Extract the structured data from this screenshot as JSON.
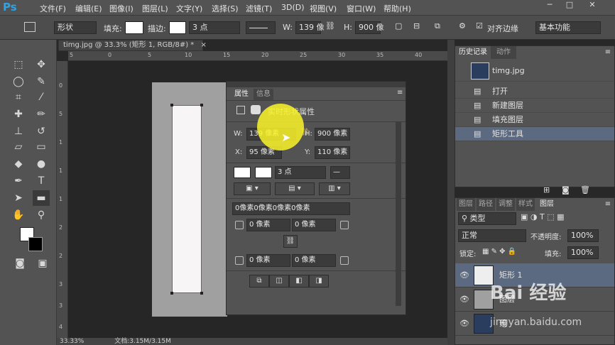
{
  "app": {
    "logo": "Ps"
  },
  "menu": [
    "文件(F)",
    "编辑(E)",
    "图像(I)",
    "图层(L)",
    "文字(Y)",
    "选择(S)",
    "滤镜(T)",
    "3D(D)",
    "视图(V)",
    "窗口(W)",
    "帮助(H)"
  ],
  "window_buttons": [
    "─",
    "□",
    "✕"
  ],
  "options": {
    "mode": "形状",
    "fill_label": "填充:",
    "stroke_label": "描边:",
    "stroke_width": "3 点",
    "w_label": "W:",
    "w_value": "139 像",
    "h_label": "H:",
    "h_value": "900 像",
    "align_edges": "对齐边缘",
    "workspace": "基本功能"
  },
  "document": {
    "tab": "timg.jpg @ 33.3% (矩形 1, RGB/8#) *",
    "tab_close": "×",
    "zoom": "33.33%",
    "doc_info": "文档:3.15M/3.15M"
  },
  "ruler_top": [
    "5",
    "0",
    "5",
    "10",
    "15",
    "20",
    "25",
    "30",
    "35",
    "40"
  ],
  "ruler_left": [
    "0",
    "5",
    "1",
    "1",
    "1",
    "2",
    "2",
    "3",
    "3",
    "4"
  ],
  "properties": {
    "tabs": [
      "属性",
      "信息"
    ],
    "title": "实时形状属性",
    "w_label": "W:",
    "w_value": "139 像素",
    "h_label": "H:",
    "h_value": "900 像素",
    "x_label": "X:",
    "x_value": "95 像素",
    "y_label": "Y:",
    "y_value": "110 像素",
    "stroke_width": "3 点",
    "radius_all": "0像素0像素0像素0像素",
    "radius_tl": "0 像素",
    "radius_tr": "0 像素",
    "radius_bl": "0 像素",
    "radius_br": "0 像素"
  },
  "history": {
    "tabs": [
      "历史记录",
      "动作"
    ],
    "snapshot": "timg.jpg",
    "items": [
      "打开",
      "新建图层",
      "填充图层",
      "矩形工具"
    ]
  },
  "layers": {
    "tabs": [
      "图层",
      "路径",
      "调整",
      "样式",
      "图层"
    ],
    "filter": "类型",
    "blend_mode": "正常",
    "opacity_label": "不透明度:",
    "opacity_value": "100%",
    "lock_label": "锁定:",
    "fill_label": "填充:",
    "fill_value": "100%",
    "rows": [
      "矩形 1",
      "图层",
      "景"
    ]
  },
  "watermark": {
    "brand": "Bai 经验",
    "url": "jingyan.baidu.com"
  },
  "colors": {
    "accent": "#2fa3e6",
    "highlight": "#faf528",
    "selected": "#5b6a80"
  }
}
